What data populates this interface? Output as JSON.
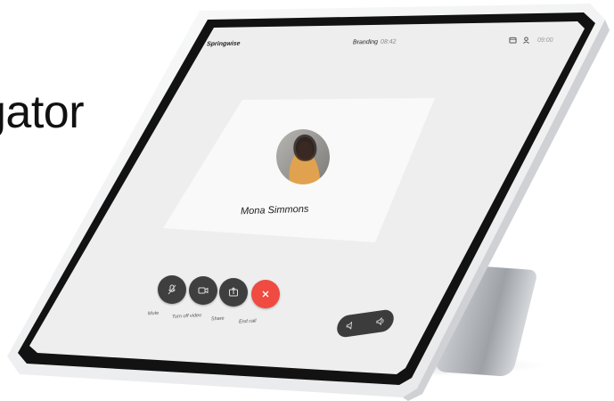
{
  "headline": {
    "text": "gator"
  },
  "status_bar": {
    "brand": "Springwise",
    "meeting_title": "Branding",
    "meeting_time": "08:42",
    "clock": "09:00",
    "icons": [
      "calendar-icon",
      "participants-icon"
    ]
  },
  "call": {
    "caller_name": "Mona Simmons"
  },
  "controls": {
    "mute": {
      "label": "Mute",
      "icon": "microphone-icon"
    },
    "video": {
      "label": "Turn off video",
      "icon": "camera-icon"
    },
    "share": {
      "label": "Share",
      "icon": "share-icon"
    },
    "end": {
      "label": "End call",
      "icon": "close-icon"
    }
  },
  "volume": {
    "down_icon": "volume-down-icon",
    "up_icon": "volume-up-icon"
  },
  "colors": {
    "end_call": "#ef4b40",
    "control_bg": "#3f3f3f",
    "screen_bg": "#eeeeee",
    "bezel": "#121212"
  }
}
